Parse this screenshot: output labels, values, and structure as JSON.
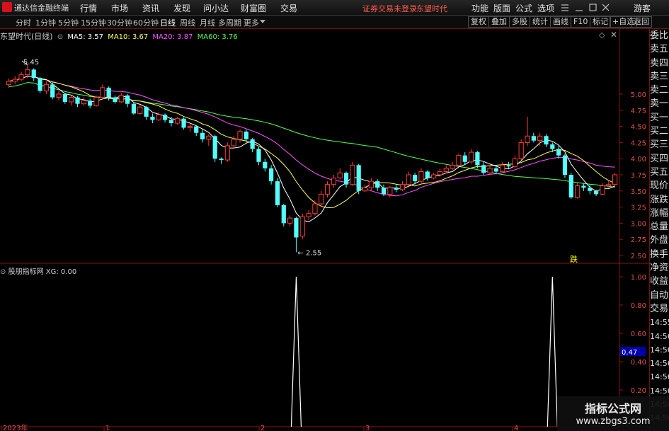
{
  "app": {
    "name": "通达信金融终端"
  },
  "menu": [
    "行情",
    "市场",
    "资讯",
    "发现",
    "问小达",
    "财富圈",
    "交易"
  ],
  "status": {
    "login": "证券交易未登录",
    "stock": "东望时代"
  },
  "menu_right": [
    "功能",
    "版面",
    "公式",
    "选项",
    "游客"
  ],
  "periods": [
    "分时",
    "1分钟",
    "5分钟",
    "15分钟",
    "30分钟",
    "60分钟",
    "日线",
    "周线",
    "月线",
    "多周期",
    "更多"
  ],
  "toolbar_right": [
    "复权",
    "叠加",
    "多股",
    "统计",
    "画线",
    "F10",
    "标记",
    "+自选",
    "返回"
  ],
  "legend": {
    "title": "东望时代(日线)",
    "ma5": "MA5: 3.57",
    "ma10": "MA10: 3.67",
    "ma20": "MA20: 3.87",
    "ma60": "MA60: 3.76",
    "colors": {
      "ma5": "#ffffff",
      "ma10": "#ffff55",
      "ma20": "#ff55ff",
      "ma60": "#55ff55"
    }
  },
  "main_axis": [
    "5.00",
    "4.75",
    "4.50",
    "4.25",
    "4.00",
    "3.75",
    "3.50",
    "3.25",
    "3.00",
    "2.75",
    "2.50"
  ],
  "annotations": {
    "high": "5.45",
    "low": "2.55",
    "fall": "跌"
  },
  "indicator": {
    "title": "股朋指标网",
    "xg": "XG: 0.00",
    "current": "0.47"
  },
  "sub_axis": [
    "1.00",
    "0.80",
    "0.60",
    "0.40",
    "0.20"
  ],
  "time_axis": [
    "2023年",
    "1",
    "2",
    "3",
    "4"
  ],
  "right_panel": [
    "委比",
    "卖五",
    "卖四",
    "卖三",
    "卖二",
    "卖一",
    "买一",
    "买二",
    "买三",
    "买四",
    "买五",
    "现价",
    "涨跌",
    "涨幅",
    "总量",
    "外盘",
    "换手",
    "净资",
    "收益",
    "自动",
    "交易",
    "14:55",
    "14:56",
    "14:56",
    "14:56",
    "14:56",
    "14:56",
    "14:56",
    "14:56"
  ],
  "watermark": {
    "line1": "指标公式网",
    "line2": "www.zbgs3.com"
  },
  "chart_data": {
    "type": "candlestick",
    "price_axis": [
      2.5,
      5.0
    ],
    "high": 5.45,
    "low": 2.55,
    "candles": [
      [
        5.15,
        5.2,
        5.24,
        5.1
      ],
      [
        5.2,
        5.23,
        5.28,
        5.16
      ],
      [
        5.23,
        5.3,
        5.35,
        5.2
      ],
      [
        5.3,
        5.38,
        5.45,
        5.25
      ],
      [
        5.38,
        5.25,
        5.4,
        5.2
      ],
      [
        5.25,
        5.05,
        5.27,
        5.02
      ],
      [
        5.05,
        5.15,
        5.2,
        5.0
      ],
      [
        5.15,
        4.95,
        5.18,
        4.92
      ],
      [
        4.95,
        5.0,
        5.05,
        4.9
      ],
      [
        5.0,
        4.88,
        5.02,
        4.85
      ],
      [
        4.88,
        4.95,
        4.98,
        4.82
      ],
      [
        4.95,
        4.85,
        4.97,
        4.8
      ],
      [
        4.85,
        4.9,
        4.95,
        4.82
      ],
      [
        4.9,
        4.82,
        4.93,
        4.78
      ],
      [
        4.82,
        4.95,
        4.98,
        4.8
      ],
      [
        4.95,
        5.1,
        5.15,
        4.92
      ],
      [
        5.1,
        4.95,
        5.12,
        4.9
      ],
      [
        4.95,
        4.88,
        4.98,
        4.85
      ],
      [
        4.88,
        4.98,
        5.02,
        4.86
      ],
      [
        4.98,
        4.85,
        5.0,
        4.8
      ],
      [
        4.85,
        4.7,
        4.88,
        4.68
      ],
      [
        4.7,
        4.8,
        4.83,
        4.68
      ],
      [
        4.8,
        4.65,
        4.82,
        4.6
      ],
      [
        4.65,
        4.6,
        4.7,
        4.55
      ],
      [
        4.6,
        4.68,
        4.72,
        4.58
      ],
      [
        4.68,
        4.6,
        4.7,
        4.56
      ],
      [
        4.6,
        4.55,
        4.65,
        4.5
      ],
      [
        4.55,
        4.62,
        4.65,
        4.52
      ],
      [
        4.62,
        4.48,
        4.64,
        4.45
      ],
      [
        4.48,
        4.5,
        4.55,
        4.42
      ],
      [
        4.5,
        4.4,
        4.52,
        4.35
      ],
      [
        4.4,
        4.3,
        4.45,
        4.25
      ],
      [
        4.3,
        4.35,
        4.38,
        4.2
      ],
      [
        4.35,
        4.0,
        4.37,
        3.95
      ],
      [
        4.0,
        3.98,
        4.02,
        3.92
      ],
      [
        3.98,
        4.2,
        4.25,
        3.95
      ],
      [
        4.2,
        4.3,
        4.35,
        4.15
      ],
      [
        4.3,
        4.42,
        4.45,
        4.25
      ],
      [
        4.42,
        4.3,
        4.45,
        4.25
      ],
      [
        4.3,
        4.15,
        4.32,
        4.1
      ],
      [
        4.15,
        3.95,
        4.18,
        3.9
      ],
      [
        3.95,
        3.85,
        4.0,
        3.8
      ],
      [
        3.85,
        3.65,
        3.9,
        3.6
      ],
      [
        3.65,
        3.28,
        3.7,
        3.25
      ],
      [
        3.28,
        3.0,
        3.3,
        2.95
      ],
      [
        3.0,
        3.08,
        3.12,
        2.95
      ],
      [
        3.08,
        2.78,
        3.1,
        2.55
      ],
      [
        2.8,
        3.1,
        3.15,
        2.75
      ],
      [
        3.1,
        3.15,
        3.2,
        3.05
      ],
      [
        3.15,
        3.3,
        3.35,
        3.12
      ],
      [
        3.3,
        3.45,
        3.5,
        3.25
      ],
      [
        3.45,
        3.6,
        3.65,
        3.4
      ],
      [
        3.6,
        3.7,
        3.75,
        3.55
      ],
      [
        3.7,
        3.78,
        3.85,
        3.68
      ],
      [
        3.78,
        3.6,
        3.8,
        3.55
      ],
      [
        3.6,
        3.9,
        3.95,
        3.58
      ],
      [
        3.9,
        3.5,
        3.92,
        3.45
      ],
      [
        3.5,
        3.55,
        3.6,
        3.48
      ],
      [
        3.55,
        3.65,
        3.7,
        3.5
      ],
      [
        3.65,
        3.55,
        3.68,
        3.5
      ],
      [
        3.55,
        3.45,
        3.6,
        3.42
      ],
      [
        3.45,
        3.55,
        3.58,
        3.4
      ],
      [
        3.55,
        3.52,
        3.6,
        3.48
      ],
      [
        3.52,
        3.6,
        3.65,
        3.5
      ],
      [
        3.6,
        3.75,
        3.8,
        3.58
      ],
      [
        3.75,
        3.65,
        3.78,
        3.6
      ],
      [
        3.65,
        3.8,
        3.85,
        3.62
      ],
      [
        3.8,
        3.7,
        3.82,
        3.66
      ],
      [
        3.7,
        3.75,
        3.78,
        3.68
      ],
      [
        3.75,
        3.8,
        3.85,
        3.72
      ],
      [
        3.8,
        3.85,
        3.9,
        3.78
      ],
      [
        3.85,
        3.9,
        3.95,
        3.82
      ],
      [
        3.9,
        4.05,
        4.08,
        3.88
      ],
      [
        4.05,
        3.95,
        4.1,
        3.9
      ],
      [
        3.95,
        4.1,
        4.15,
        3.92
      ],
      [
        4.1,
        3.9,
        4.12,
        3.85
      ],
      [
        3.9,
        3.78,
        3.95,
        3.75
      ],
      [
        3.78,
        3.85,
        3.9,
        3.75
      ],
      [
        3.85,
        3.8,
        3.9,
        3.76
      ],
      [
        3.8,
        3.9,
        3.95,
        3.78
      ],
      [
        3.9,
        3.88,
        3.95,
        3.85
      ],
      [
        3.88,
        4.0,
        4.05,
        3.85
      ],
      [
        4.0,
        4.25,
        4.3,
        3.98
      ],
      [
        4.25,
        4.35,
        4.65,
        4.2
      ],
      [
        4.35,
        4.28,
        4.4,
        4.25
      ],
      [
        4.28,
        4.35,
        4.4,
        4.2
      ],
      [
        4.35,
        4.22,
        4.38,
        4.18
      ],
      [
        4.22,
        4.15,
        4.25,
        4.1
      ],
      [
        4.15,
        4.05,
        4.2,
        4.0
      ],
      [
        4.05,
        3.75,
        4.08,
        3.7
      ],
      [
        3.75,
        3.4,
        3.78,
        3.38
      ],
      [
        3.4,
        3.58,
        3.62,
        3.38
      ],
      [
        3.58,
        3.55,
        3.62,
        3.5
      ],
      [
        3.55,
        3.5,
        3.6,
        3.45
      ],
      [
        3.5,
        3.45,
        3.52,
        3.42
      ],
      [
        3.45,
        3.58,
        3.62,
        3.43
      ],
      [
        3.58,
        3.6,
        3.65,
        3.55
      ],
      [
        3.6,
        3.75,
        3.78,
        3.58
      ]
    ],
    "indicator_XG": {
      "signal_days": [
        46,
        87
      ],
      "value": 1.0
    }
  }
}
